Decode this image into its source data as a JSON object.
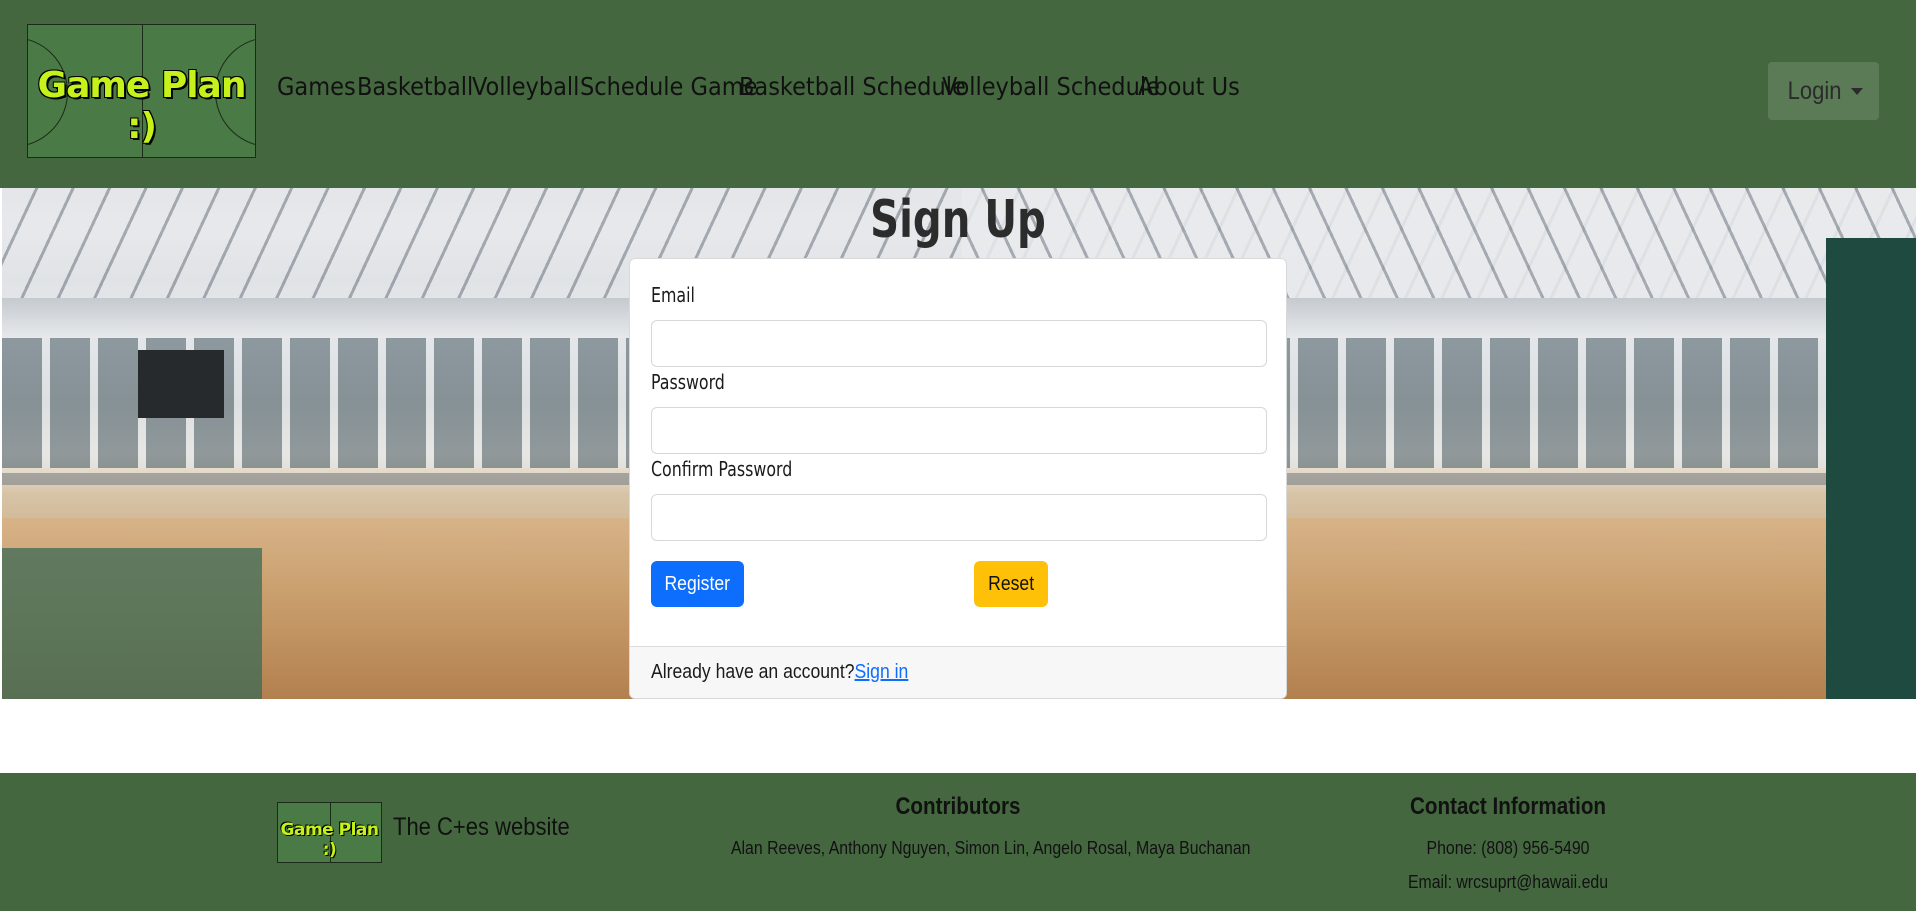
{
  "navbar": {
    "logo_text": "Game Plan :)",
    "links": [
      "Games",
      "Basketball",
      "Volleyball",
      "Schedule Game",
      "Basketball Schedule",
      "Volleyball Schedule",
      "About Us"
    ],
    "login_label": "Login"
  },
  "page": {
    "title": "Sign Up"
  },
  "form": {
    "email_label": "Email",
    "email_value": "",
    "password_label": "Password",
    "password_value": "",
    "confirm_label": "Confirm Password",
    "confirm_value": "",
    "register_label": "Register",
    "reset_label": "Reset",
    "footer_text": "Already have an account?",
    "signin_label": "Sign in"
  },
  "footer": {
    "logo_text": "Game Plan :)",
    "tagline": "The C+es website",
    "contributors_heading": "Contributors",
    "contributors": "Alan Reeves, Anthony Nguyen, Simon Lin, Angelo Rosal, Maya Buchanan",
    "contact_heading": "Contact Information",
    "phone": "Phone: (808) 956-5490",
    "email": "Email: wrcsuprt@hawaii.edu"
  },
  "colors": {
    "nav_bg": "#44673f",
    "primary": "#0d6efd",
    "warning": "#ffc107",
    "logo_text": "#c6f21b"
  }
}
